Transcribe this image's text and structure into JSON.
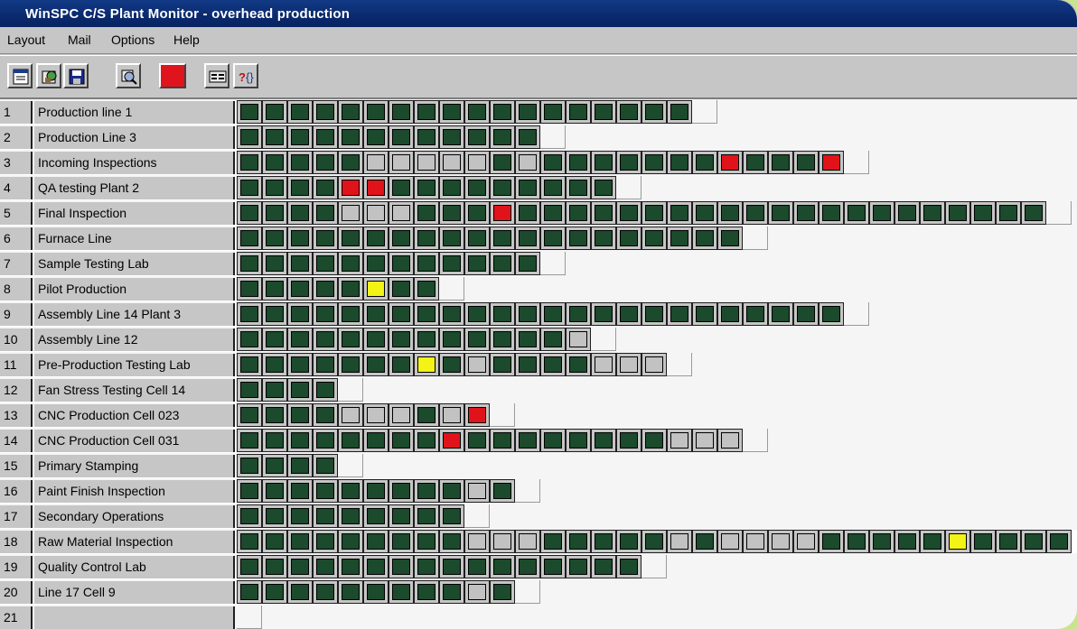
{
  "window": {
    "title": "WinSPC C/S Plant Monitor - overhead production"
  },
  "menu": [
    {
      "label": "Layout"
    },
    {
      "label": "Mail"
    },
    {
      "label": "Options"
    },
    {
      "label": "Help"
    }
  ],
  "toolbar": [
    {
      "icon": "new-layout-icon"
    },
    {
      "icon": "open-layout-icon"
    },
    {
      "icon": "save-icon"
    },
    {
      "icon": "search-monitor-icon"
    },
    {
      "icon": "alarm-status-icon",
      "color": "#e0141c"
    },
    {
      "icon": "display-options-icon"
    },
    {
      "icon": "help-context-icon"
    }
  ],
  "status_colors": {
    "G": "#1b4a2c",
    "S": "#c2c2c2",
    "R": "#e1131a",
    "Y": "#f3f316"
  },
  "rows": [
    {
      "num": "1",
      "label": "Production line 1",
      "cells": "GGGGGGGGGGGGGGGGGG"
    },
    {
      "num": "2",
      "label": "Production Line 3",
      "cells": "GGGGGGGGGGGG"
    },
    {
      "num": "3",
      "label": "Incoming Inspections",
      "cells": "GGGGGSSSSSGSGGGGGGGRGGGR"
    },
    {
      "num": "4",
      "label": "QA testing Plant 2",
      "cells": "GGGGRRGGGGGGGGG"
    },
    {
      "num": "5",
      "label": "Final Inspection",
      "cells": "GGGGSSSGGGRGGGGGGGGGGGGGGGGGGGGG"
    },
    {
      "num": "6",
      "label": "Furnace Line",
      "cells": "GGGGGGGGGGGGGGGGGGGG"
    },
    {
      "num": "7",
      "label": "Sample Testing Lab",
      "cells": "GGGGGGGGGGGG"
    },
    {
      "num": "8",
      "label": "Pilot Production",
      "cells": "GGGGGYGG"
    },
    {
      "num": "9",
      "label": "Assembly Line 14 Plant 3",
      "cells": "GGGGGGGGGGGGGGGGGGGGGGGG"
    },
    {
      "num": "10",
      "label": "Assembly Line 12",
      "cells": "GGGGGGGGGGGGGS"
    },
    {
      "num": "11",
      "label": "Pre-Production Testing Lab",
      "cells": "GGGGGGGYGSGGGGSSS"
    },
    {
      "num": "12",
      "label": "Fan Stress Testing Cell 14",
      "cells": "GGGG"
    },
    {
      "num": "13",
      "label": "CNC Production Cell 023",
      "cells": "GGGGSSSGSR"
    },
    {
      "num": "14",
      "label": "CNC Production Cell 031",
      "cells": "GGGGGGGGRGGGGGGGGSSS"
    },
    {
      "num": "15",
      "label": "Primary Stamping",
      "cells": "GGGG"
    },
    {
      "num": "16",
      "label": "Paint Finish Inspection",
      "cells": "GGGGGGGGGSG"
    },
    {
      "num": "17",
      "label": "Secondary Operations",
      "cells": "GGGGGGGGG"
    },
    {
      "num": "18",
      "label": "Raw Material Inspection",
      "cells": "GGGGGGGGGSSSGGGGGSGSSSSGGGGGYGGGGG"
    },
    {
      "num": "19",
      "label": "Quality Control Lab",
      "cells": "GGGGGGGGGGGGGGGG"
    },
    {
      "num": "20",
      "label": "Line 17 Cell 9",
      "cells": "GGGGGGGGGSG"
    },
    {
      "num": "21",
      "label": "",
      "cells": ""
    }
  ]
}
